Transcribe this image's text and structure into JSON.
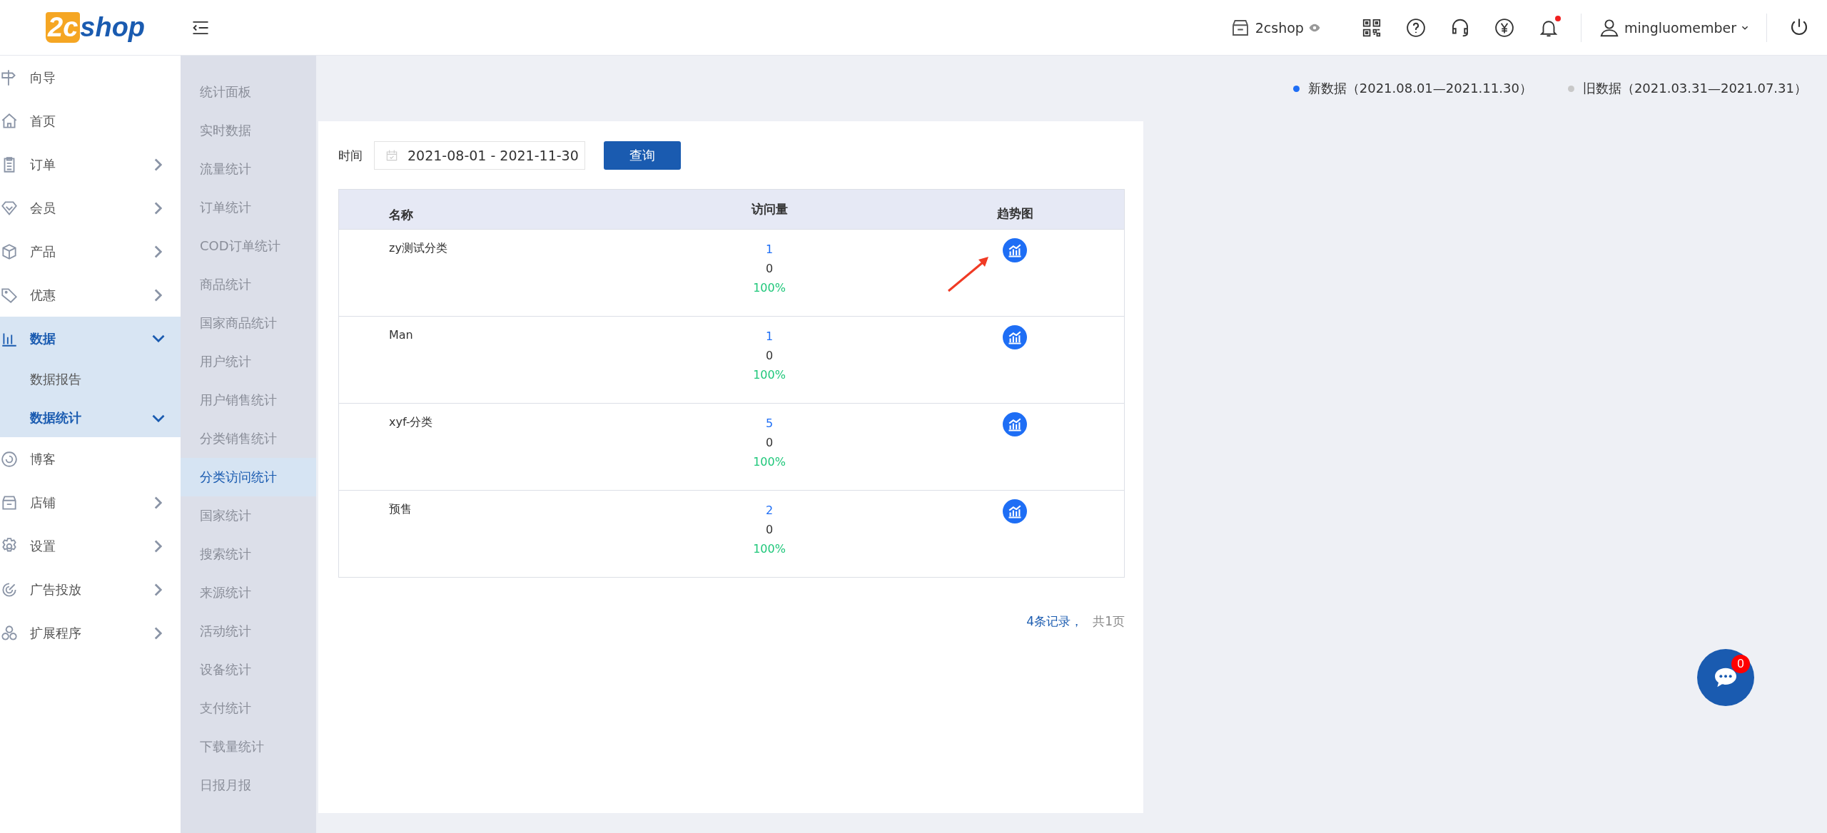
{
  "topbar": {
    "logo": {
      "mark": "2c",
      "name": "shop"
    },
    "store": "2cshop",
    "notifications_unread": true,
    "user": "mingluomember"
  },
  "sidebar": {
    "items": [
      {
        "label": "向导",
        "selected": false
      },
      {
        "label": "首页",
        "selected": false
      },
      {
        "label": "订单",
        "expanded": false,
        "selected": false
      },
      {
        "label": "会员",
        "expanded": false,
        "selected": false
      },
      {
        "label": "产品",
        "expanded": false,
        "selected": false
      },
      {
        "label": "优惠",
        "expanded": false,
        "selected": false
      },
      {
        "label": "数据",
        "expanded": true,
        "selected": true,
        "children": [
          {
            "label": "数据报告",
            "selected": false
          },
          {
            "label": "数据统计",
            "expanded": true,
            "selected": true
          }
        ]
      },
      {
        "label": "博客",
        "selected": false
      },
      {
        "label": "店铺",
        "expanded": false,
        "selected": false
      },
      {
        "label": "设置",
        "expanded": false,
        "selected": false
      },
      {
        "label": "广告投放",
        "expanded": false,
        "selected": false
      },
      {
        "label": "扩展程序",
        "expanded": false,
        "selected": false
      }
    ]
  },
  "subnav": [
    {
      "label": "统计面板",
      "selected": false
    },
    {
      "label": "实时数据",
      "selected": false
    },
    {
      "label": "流量统计",
      "selected": false
    },
    {
      "label": "订单统计",
      "selected": false
    },
    {
      "label": "COD订单统计",
      "selected": false
    },
    {
      "label": "商品统计",
      "selected": false
    },
    {
      "label": "国家商品统计",
      "selected": false
    },
    {
      "label": "用户统计",
      "selected": false
    },
    {
      "label": "用户销售统计",
      "selected": false
    },
    {
      "label": "分类销售统计",
      "selected": false
    },
    {
      "label": "分类访问统计",
      "selected": true
    },
    {
      "label": "国家统计",
      "selected": false
    },
    {
      "label": "搜索统计",
      "selected": false
    },
    {
      "label": "来源统计",
      "selected": false
    },
    {
      "label": "活动统计",
      "selected": false
    },
    {
      "label": "设备统计",
      "selected": false
    },
    {
      "label": "支付统计",
      "selected": false
    },
    {
      "label": "下载量统计",
      "selected": false
    },
    {
      "label": "日报月报",
      "selected": false
    }
  ],
  "legend": [
    {
      "label": "新数据（2021.08.01—2021.11.30）",
      "color": "#1e6ef5"
    },
    {
      "label": "旧数据（2021.03.31—2021.07.31）",
      "color": "#c8c8c8"
    }
  ],
  "filter": {
    "label": "时间",
    "date_range": "2021-08-01 - 2021-11-30",
    "button": "查询"
  },
  "table": {
    "columns": [
      "名称",
      "访问量",
      "趋势图"
    ],
    "rows": [
      {
        "name": "zy测试分类",
        "visits": "1",
        "previous": "0",
        "change": "100%"
      },
      {
        "name": "Man",
        "visits": "1",
        "previous": "0",
        "change": "100%"
      },
      {
        "name": "xyf-分类",
        "visits": "5",
        "previous": "0",
        "change": "100%"
      },
      {
        "name": "预售",
        "visits": "2",
        "previous": "0",
        "change": "100%"
      }
    ]
  },
  "pagination": {
    "records": "4条记录，",
    "pages": "共1页"
  },
  "chat": {
    "badge": "0"
  }
}
